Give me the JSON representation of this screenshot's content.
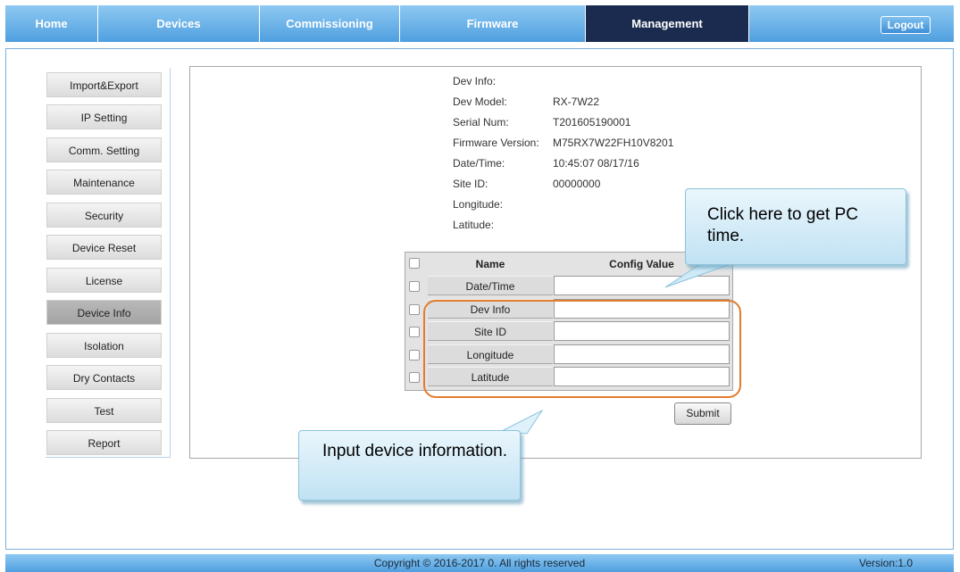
{
  "nav": {
    "tabs": [
      {
        "label": "Home"
      },
      {
        "label": "Devices"
      },
      {
        "label": "Commissioning"
      },
      {
        "label": "Firmware"
      },
      {
        "label": "Management",
        "active": true
      }
    ],
    "logout_label": "Logout"
  },
  "sidebar": {
    "items": [
      {
        "label": "Import&Export"
      },
      {
        "label": "IP Setting"
      },
      {
        "label": "Comm. Setting"
      },
      {
        "label": "Maintenance"
      },
      {
        "label": "Security"
      },
      {
        "label": "Device Reset"
      },
      {
        "label": "License"
      },
      {
        "label": "Device Info",
        "active": true
      },
      {
        "label": "Isolation"
      },
      {
        "label": "Dry Contacts"
      },
      {
        "label": "Test"
      },
      {
        "label": "Report"
      }
    ]
  },
  "device_info": {
    "heading": "Dev Info:",
    "fields": [
      {
        "label": "Dev Model:",
        "value": "RX-7W22"
      },
      {
        "label": "Serial Num:",
        "value": "T201605190001"
      },
      {
        "label": "Firmware Version:",
        "value": "M75RX7W22FH10V8201"
      },
      {
        "label": "Date/Time:",
        "value": "10:45:07 08/17/16"
      },
      {
        "label": "Site ID:",
        "value": "00000000"
      },
      {
        "label": "Longitude:",
        "value": ""
      },
      {
        "label": "Latitude:",
        "value": ""
      }
    ]
  },
  "config_table": {
    "header_name": "Name",
    "header_value": "Config Value",
    "rows": [
      {
        "name": "Date/Time",
        "value": ""
      },
      {
        "name": "Dev Info",
        "value": ""
      },
      {
        "name": "Site ID",
        "value": ""
      },
      {
        "name": "Longitude",
        "value": ""
      },
      {
        "name": "Latitude",
        "value": ""
      }
    ]
  },
  "submit_label": "Submit",
  "callouts": {
    "pc_time": "Click here to get PC time.",
    "input_info": "Input device information."
  },
  "footer": {
    "copyright": "Copyright © 2016-2017 0. All rights reserved",
    "version": "Version:1.0"
  },
  "colors": {
    "nav_gradient_top": "#8ec9f2",
    "nav_gradient_bottom": "#4f9fdf",
    "active_tab": "#1a2b4f",
    "highlight_border": "#e27c2c",
    "callout_fill": "#c0e2f3"
  }
}
